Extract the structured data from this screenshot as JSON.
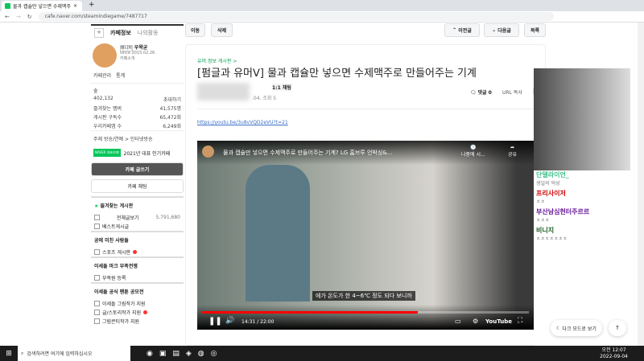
{
  "browser": {
    "tab_title": "물과 캡슐만 넣으면 수제맥주",
    "url": "cafe.naver.com/steamindiegame/7487717"
  },
  "sidebar": {
    "tab_info": "카페정보",
    "tab_activity": "나의활동",
    "manager_badge": "매니저",
    "manager": "우왁굳",
    "since": "since 2015.02.26.",
    "intro": "카페소개",
    "manage": "카페관리",
    "stats": "통계",
    "level": "숲",
    "members": "402,132",
    "invite": "초대하기",
    "fav_members_label": "즐겨찾는 멤버",
    "fav_members": "41,575명",
    "board_sub_label": "게시판 구독수",
    "board_sub": "65,472회",
    "cafe_app_label": "우리카페앱 수",
    "cafe_app": "6,249회",
    "theme": "주제 방송/연예 > 인터넷방송",
    "naver_badge": "NAVER 대표카페",
    "award": "2021년 대표 인기카페",
    "write_btn": "카페 글쓰기",
    "chat_btn": "카페 채팅",
    "fav_boards": "즐겨찾는 게시판",
    "all_posts": "전체글보기",
    "all_count": "5,791,680",
    "best": "베스트게시글",
    "sec1": "공에 미친 사람들",
    "sports": "스포츠 게시판",
    "sec2": "이세돌 마크 부족전쟁",
    "tribe": "부족원 등록",
    "sec3": "이세돌 공식 팬툰 공모전",
    "b1": "이세돌 그림작가 지원",
    "b2": "글/스토리작가 지원",
    "b3": "그림콘티작가 지원"
  },
  "toolbar": {
    "move": "이동",
    "delete": "삭제",
    "prev": "이전글",
    "next": "다음글",
    "list": "목록"
  },
  "article": {
    "board": "유머.정보 게시판 >",
    "title": "[펌글과 유머ᐯ] 물과 캡슐만 넣으면 수제맥주로 만들어주는 기계",
    "chat": "1:1 채팅",
    "views": ".04. 조회 5",
    "comments": "댓글 0",
    "url_copy": "URL 복사",
    "link": "https://youtu.be/3u8vVQD2eVU?t=21"
  },
  "video": {
    "title": "물과 캡슐만 넣으면 수제맥주로 만들어주는 기계? LG 홈브루 언박싱&...",
    "watch_later": "나중에 시...",
    "share": "공유",
    "subtitle": "에가 온도가 한 4~6℃ 정도 되다 보니까",
    "time": "14:31 / 22:00",
    "progress": 0.66,
    "brand": "YouTube"
  },
  "chat": [
    {
      "name": "단델라이언_",
      "msg": "생일의 억성",
      "color": "#3cc08a"
    },
    {
      "name": "프리사이저",
      "msg": "ㅊㅊ",
      "color": "#c00"
    },
    {
      "name": "부산남심헌터주르르",
      "msg": "ㅊㅊㅊ",
      "color": "#6a1b9a"
    },
    {
      "name": "비니지",
      "msg": "ㅊㅊㅊㅊㅊㅊㅊ",
      "color": "#1b5e20"
    }
  ],
  "floating": {
    "dark": "다크 모드로 보기"
  },
  "taskbar": {
    "search": "검색하려면 여기에 입력하십시오",
    "time": "오전 12:07",
    "date": "2022-09-04"
  }
}
